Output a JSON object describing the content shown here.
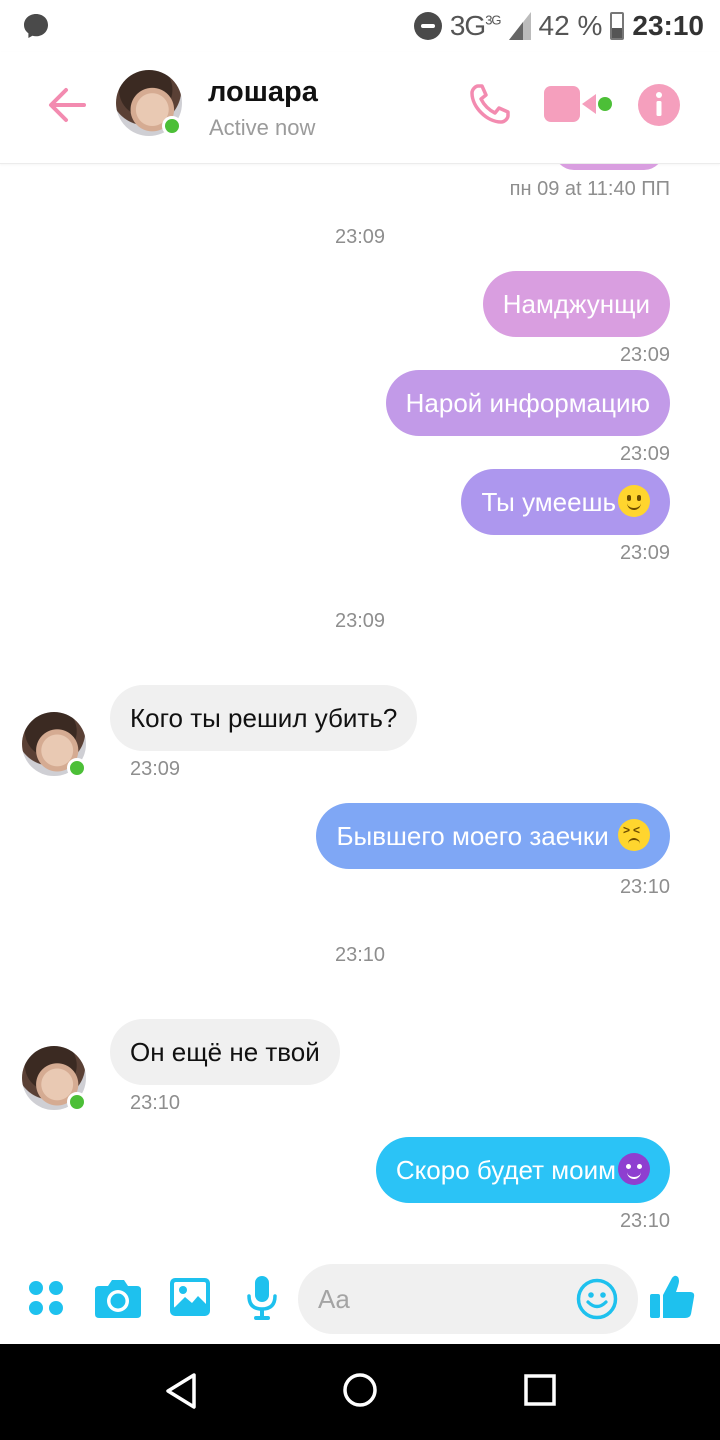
{
  "status_bar": {
    "network": "3G",
    "network_sup": "3G",
    "battery": "42 %",
    "battery_level": 0.42,
    "time": "23:10",
    "icons": [
      "messenger-notification-icon",
      "do-not-disturb-icon",
      "signal-icon",
      "battery-icon"
    ]
  },
  "header": {
    "contact_name": "лошара",
    "status": "Active now",
    "accent_color": "#f27fa6"
  },
  "chat": {
    "top_timestamp": "пн 09 at 11:40 ПП",
    "separators": [
      "23:09",
      "23:09",
      "23:10"
    ],
    "messages": [
      {
        "dir": "out",
        "text": "Намджунщи",
        "time": "23:09",
        "color": "#d99ee0"
      },
      {
        "dir": "out",
        "text": "Нарой информацию",
        "time": "23:09",
        "color": "#c29ae8"
      },
      {
        "dir": "out",
        "text": "Ты умеешь",
        "emoji": "slightly-smiling-face",
        "time": "23:09",
        "color": "#ad97ee"
      },
      {
        "dir": "in",
        "text": "Кого ты решил убить?",
        "time": "23:09"
      },
      {
        "dir": "out",
        "text": "Бывшего моего заечки ",
        "emoji": "tired-face",
        "time": "23:10",
        "color": "#7fa7f5"
      },
      {
        "dir": "in",
        "text": "Он ещё не твой",
        "time": "23:10"
      },
      {
        "dir": "out",
        "text": "Скоро будет моим",
        "emoji": "smiling-face-with-horns",
        "time": "23:10",
        "color": "#2bc3f6"
      }
    ]
  },
  "composer": {
    "placeholder": "Aa",
    "accent_color": "#1ec1ee"
  }
}
